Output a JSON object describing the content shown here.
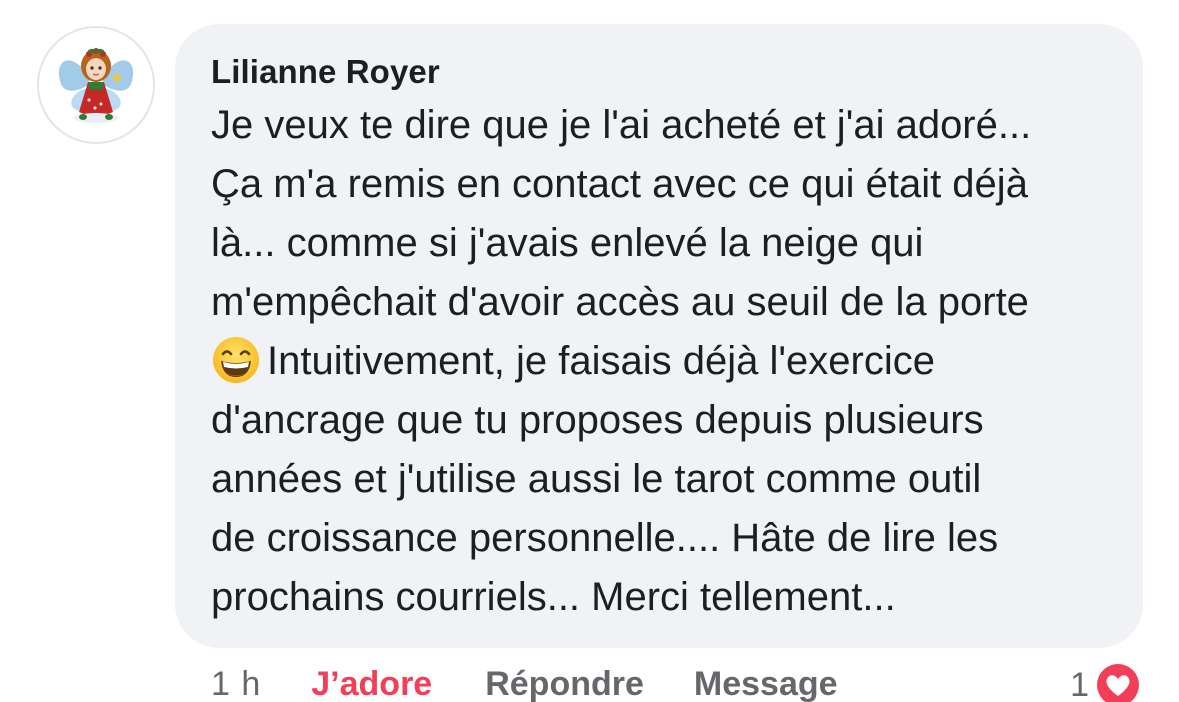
{
  "comment": {
    "author": "Lilianne Royer",
    "lines": [
      "Je veux te dire que je l'ai acheté et j'ai adoré...",
      "Ça m'a remis en contact avec ce qui était déjà",
      "là... comme si j'avais enlevé la neige qui",
      "m'empêchait d'avoir accès au seuil de la porte",
      "Intuitivement, je faisais déjà l'exercice",
      "d'ancrage que tu proposes depuis plusieurs",
      "années et j'utilise aussi le tarot comme outil",
      "de croissance personnelle.... Hâte de lire les",
      "prochains courriels... Merci tellement..."
    ],
    "emoji": "grinning-face-with-smiling-eyes"
  },
  "actions": {
    "time": "1 h",
    "like_label": "J’adore",
    "reply_label": "Répondre",
    "message_label": "Message"
  },
  "reactions": {
    "count": "1",
    "icon": "love-heart-icon"
  },
  "colors": {
    "bubble": "#f0f2f5",
    "text": "#1c1e21",
    "secondary": "#65676b",
    "love": "#f33e58"
  }
}
